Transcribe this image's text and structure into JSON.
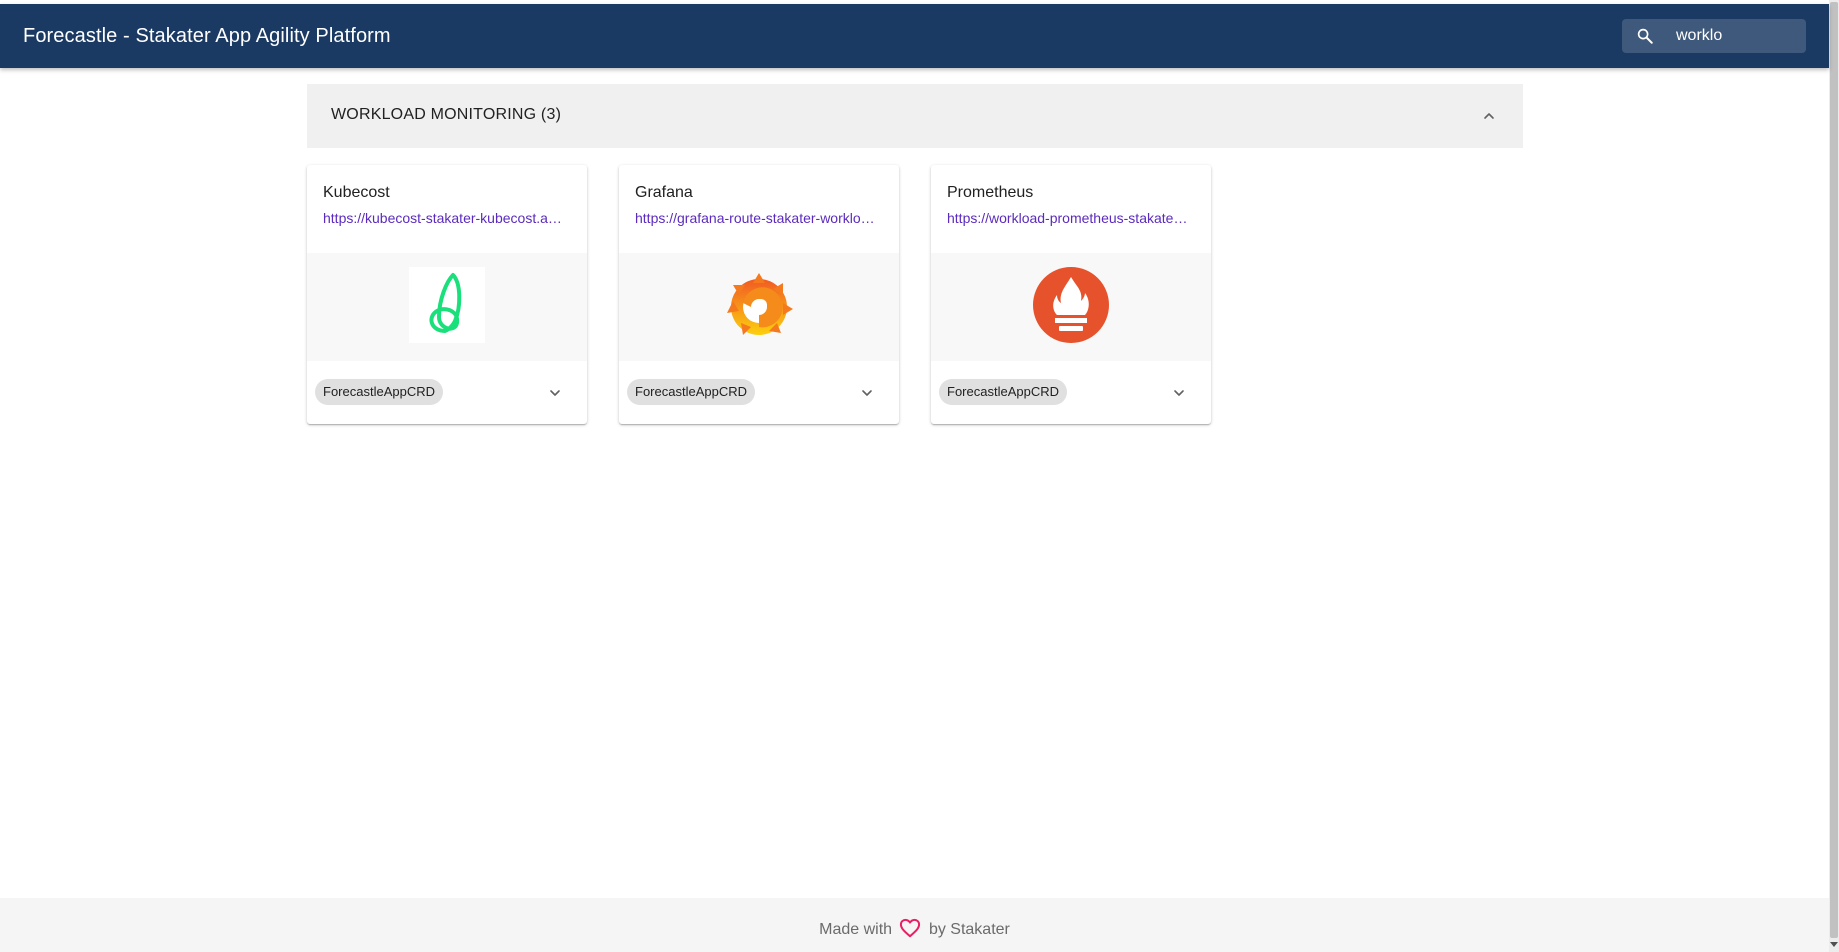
{
  "app": {
    "title": "Forecastle - Stakater App Agility Platform",
    "accent_color": "#1b3a63"
  },
  "search": {
    "icon": "search-icon",
    "value": "worklo"
  },
  "group": {
    "title": "WORKLOAD MONITORING (3)",
    "collapse_icon": "chevron-up-icon",
    "background": "#f0f0f0"
  },
  "cards": [
    {
      "name": "Kubecost",
      "url": "https://kubecost-stakater-kubecost.apps.example.com",
      "url_display": "https://kubecost-stakater-kubecost.a…",
      "logo": "kubecost-logo",
      "tag": "ForecastleAppCRD",
      "expand_icon": "chevron-down-icon"
    },
    {
      "name": "Grafana",
      "url": "https://grafana-route-stakater-workload-monitoring.apps.example.com",
      "url_display": "https://grafana-route-stakater-worklo…",
      "logo": "grafana-logo",
      "tag": "ForecastleAppCRD",
      "expand_icon": "chevron-down-icon"
    },
    {
      "name": "Prometheus",
      "url": "https://workload-prometheus-stakater-workload-monitoring.apps.example.com",
      "url_display": "https://workload-prometheus-stakate…",
      "logo": "prometheus-logo",
      "tag": "ForecastleAppCRD",
      "expand_icon": "chevron-down-icon"
    }
  ],
  "footer": {
    "prefix": "Made with",
    "heart_icon": "heart-icon",
    "suffix": "by Stakater",
    "heart_color": "#e91e63"
  }
}
